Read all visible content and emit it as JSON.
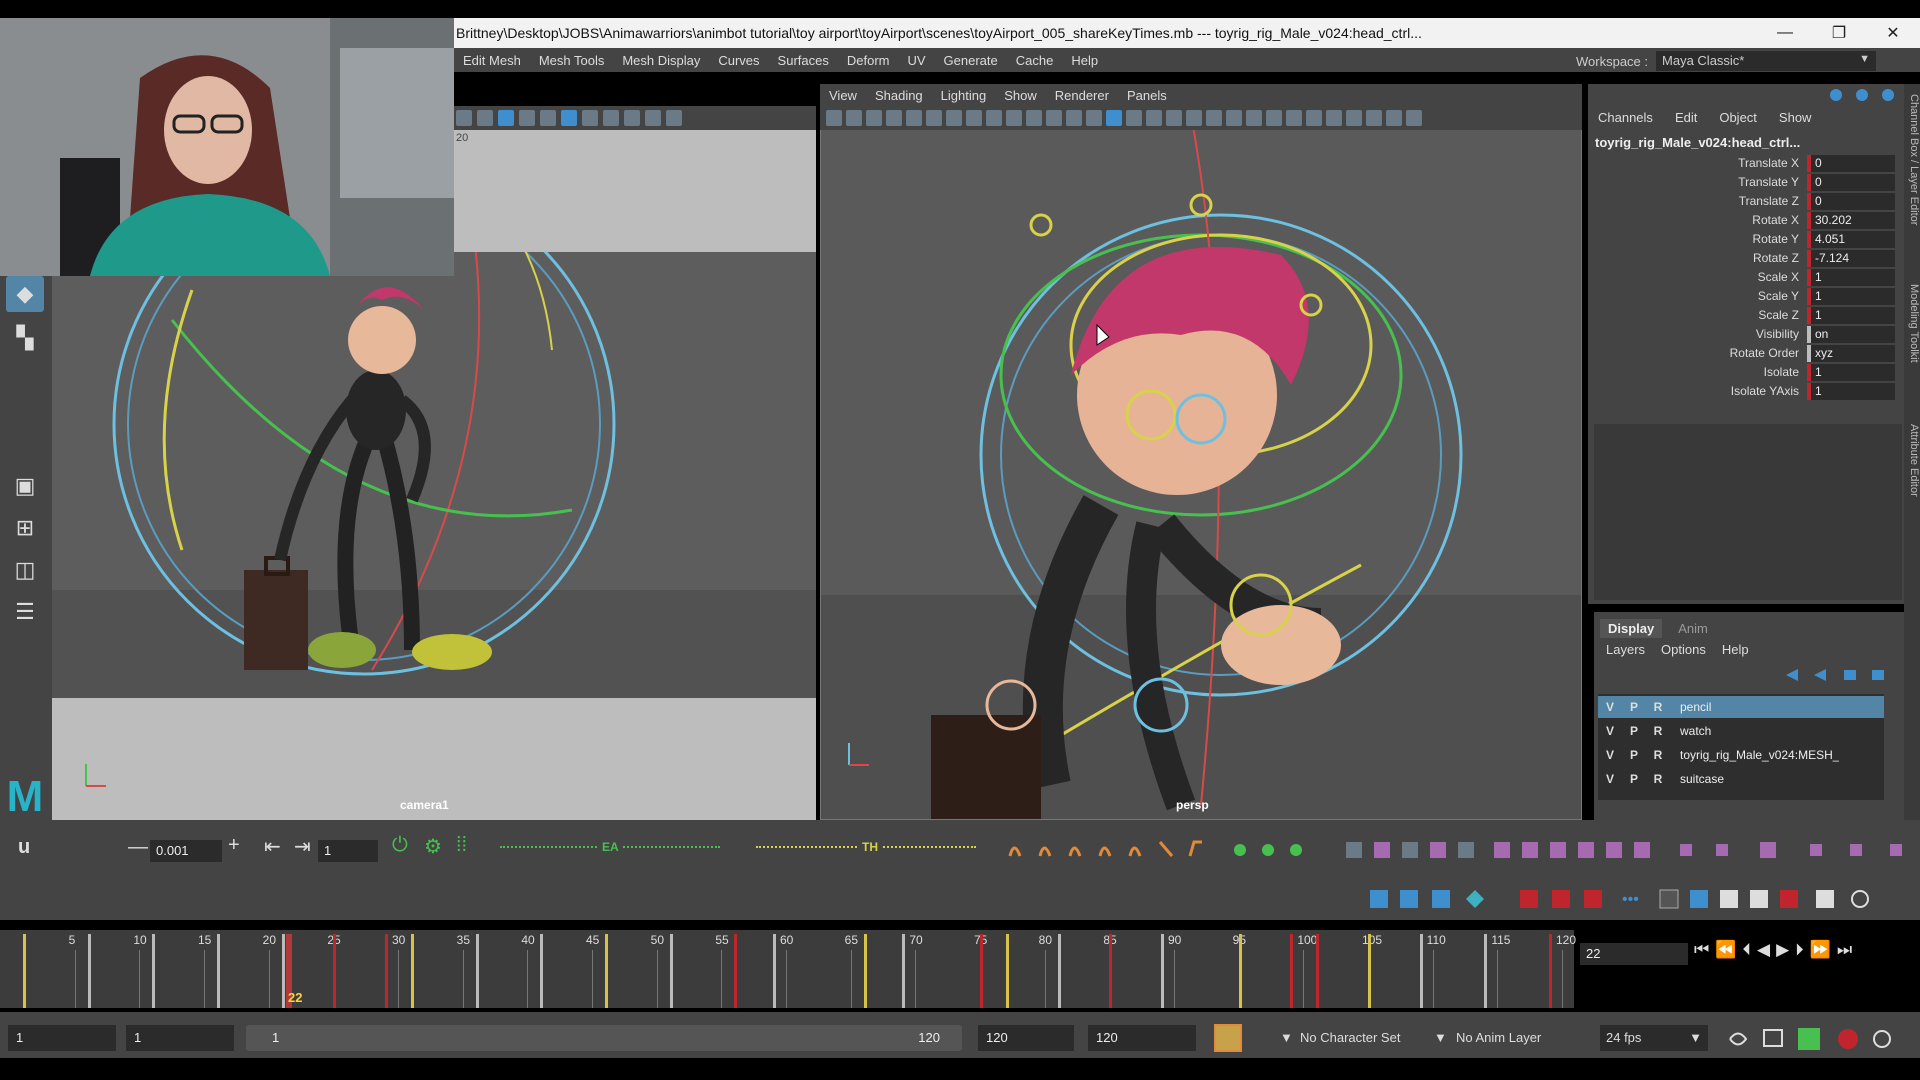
{
  "window": {
    "title": "Brittney\\Desktop\\JOBS\\Animawarriors\\animbot tutorial\\toy airport\\toyAirport\\scenes\\toyAirport_005_shareKeyTimes.mb  ---  toyrig_rig_Male_v024:head_ctrl...",
    "minimize": "—",
    "restore": "❐",
    "close": "✕"
  },
  "main_menu": [
    "Edit Mesh",
    "Mesh Tools",
    "Mesh Display",
    "Curves",
    "Surfaces",
    "Deform",
    "UV",
    "Generate",
    "Cache",
    "Help"
  ],
  "workspace": {
    "label": "Workspace :",
    "value": "Maya Classic*"
  },
  "left_viewport": {
    "camera_label": "camera1",
    "ruler_mark": "20"
  },
  "right_viewport": {
    "menu": [
      "View",
      "Shading",
      "Lighting",
      "Show",
      "Renderer",
      "Panels"
    ],
    "camera_label": "persp"
  },
  "channel_box": {
    "menu": [
      "Channels",
      "Edit",
      "Object",
      "Show"
    ],
    "object_name": "toyrig_rig_Male_v024:head_ctrl...",
    "attributes": [
      {
        "label": "Translate X",
        "value": "0"
      },
      {
        "label": "Translate Y",
        "value": "0"
      },
      {
        "label": "Translate Z",
        "value": "0"
      },
      {
        "label": "Rotate X",
        "value": "30.202"
      },
      {
        "label": "Rotate Y",
        "value": "4.051"
      },
      {
        "label": "Rotate Z",
        "value": "-7.124"
      },
      {
        "label": "Scale X",
        "value": "1"
      },
      {
        "label": "Scale Y",
        "value": "1"
      },
      {
        "label": "Scale Z",
        "value": "1"
      },
      {
        "label": "Visibility",
        "value": "on"
      },
      {
        "label": "Rotate Order",
        "value": "xyz"
      },
      {
        "label": "Isolate",
        "value": "1"
      },
      {
        "label": "Isolate YAxis",
        "value": "1"
      }
    ],
    "side_tabs": [
      "Channel Box / Layer Editor",
      "Modeling Toolkit",
      "Attribute Editor"
    ]
  },
  "layer_editor": {
    "tabs": [
      "Display",
      "Anim"
    ],
    "menu": [
      "Layers",
      "Options",
      "Help"
    ],
    "layers": [
      {
        "v": "V",
        "p": "P",
        "r": "R",
        "name": "pencil",
        "selected": true
      },
      {
        "v": "V",
        "p": "P",
        "r": "R",
        "name": "watch",
        "selected": false
      },
      {
        "v": "V",
        "p": "P",
        "r": "R",
        "name": "toyrig_rig_Male_v024:MESH_",
        "selected": false
      },
      {
        "v": "V",
        "p": "P",
        "r": "R",
        "name": "suitcase",
        "selected": false
      }
    ]
  },
  "shelf": {
    "step_value": "0.001",
    "frame_value": "1",
    "label_ea": "EA",
    "label_th": "TH"
  },
  "timeline": {
    "ticks": [
      "5",
      "10",
      "15",
      "20",
      "25",
      "30",
      "35",
      "40",
      "45",
      "50",
      "55",
      "60",
      "65",
      "70",
      "75",
      "80",
      "85",
      "90",
      "95",
      "100",
      "105",
      "110",
      "115",
      "120"
    ],
    "current_frame": "22",
    "frame_field": "22",
    "keys": [
      {
        "frame": 1,
        "color": "#d7c24a"
      },
      {
        "frame": 6,
        "color": "#bbbbbb"
      },
      {
        "frame": 11,
        "color": "#bbbbbb"
      },
      {
        "frame": 16,
        "color": "#bbbbbb"
      },
      {
        "frame": 21,
        "color": "#bbbbbb"
      },
      {
        "frame": 25,
        "color": "#c0242c"
      },
      {
        "frame": 29,
        "color": "#c0242c"
      },
      {
        "frame": 31,
        "color": "#d7c24a"
      },
      {
        "frame": 36,
        "color": "#bbbbbb"
      },
      {
        "frame": 41,
        "color": "#bbbbbb"
      },
      {
        "frame": 46,
        "color": "#d7c24a"
      },
      {
        "frame": 51,
        "color": "#bbbbbb"
      },
      {
        "frame": 56,
        "color": "#c0242c"
      },
      {
        "frame": 59,
        "color": "#bbbbbb"
      },
      {
        "frame": 66,
        "color": "#d7c24a"
      },
      {
        "frame": 69,
        "color": "#bbbbbb"
      },
      {
        "frame": 75,
        "color": "#c0242c"
      },
      {
        "frame": 77,
        "color": "#d7c24a"
      },
      {
        "frame": 81,
        "color": "#bbbbbb"
      },
      {
        "frame": 85,
        "color": "#c0242c"
      },
      {
        "frame": 89,
        "color": "#bbbbbb"
      },
      {
        "frame": 95,
        "color": "#d7c24a"
      },
      {
        "frame": 99,
        "color": "#c0242c"
      },
      {
        "frame": 101,
        "color": "#c0242c"
      },
      {
        "frame": 105,
        "color": "#d7c24a"
      },
      {
        "frame": 109,
        "color": "#bbbbbb"
      },
      {
        "frame": 114,
        "color": "#bbbbbb"
      },
      {
        "frame": 119,
        "color": "#c0242c"
      }
    ]
  },
  "range": {
    "start": "1",
    "playback_start": "1",
    "slider_start": "1",
    "slider_end": "120",
    "playback_end": "120",
    "end": "120",
    "character_set": "No Character Set",
    "anim_layer": "No Anim Layer",
    "fps": "24 fps"
  },
  "colors": {
    "ui_panel": "#444444",
    "viewport_bg": "#5d5d5d",
    "key_red": "#c0242c",
    "key_yellow": "#d7c24a",
    "selection_blue": "#5285a6",
    "ctrl_cyan": "#6ec0e0",
    "ctrl_yellow": "#d8d24a",
    "ctrl_green": "#48c050",
    "hair_magenta": "#c2386a"
  }
}
